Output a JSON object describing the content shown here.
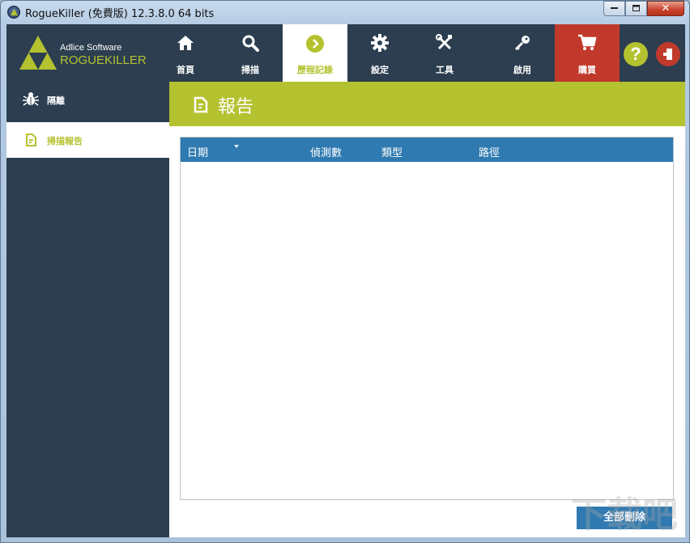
{
  "window": {
    "title": "RogueKiller (免費版) 12.3.8.0 64 bits",
    "minimize": "▭",
    "maximize": "□",
    "close": "✕"
  },
  "logo": {
    "company": "Adlice Software",
    "product": "ROGUEKILLER"
  },
  "nav": {
    "tabs": [
      {
        "label": "首頁",
        "icon": "home-icon"
      },
      {
        "label": "掃描",
        "icon": "search-icon"
      },
      {
        "label": "歷程記錄",
        "icon": "chevron-right-circle-icon",
        "active": true
      },
      {
        "label": "設定",
        "icon": "gear-icon"
      },
      {
        "label": "工具",
        "icon": "tools-icon"
      },
      {
        "label": "啟用",
        "icon": "key-icon"
      },
      {
        "label": "購買",
        "icon": "cart-icon"
      }
    ],
    "help": "?"
  },
  "sidebar": {
    "items": [
      {
        "label": "隔離",
        "icon": "bug-icon"
      },
      {
        "label": "掃描報告",
        "icon": "report-icon",
        "active": true
      }
    ]
  },
  "banner": {
    "title": "報告"
  },
  "table": {
    "columns": [
      "日期",
      "偵測數",
      "類型",
      "路徑"
    ],
    "rows": []
  },
  "actions": {
    "delete_all": "全部刪除"
  },
  "colors": {
    "header_bg": "#2c3e50",
    "accent": "#b5c230",
    "table_header": "#2f7ab0",
    "buy": "#c0392b"
  },
  "watermark": "下载吧"
}
